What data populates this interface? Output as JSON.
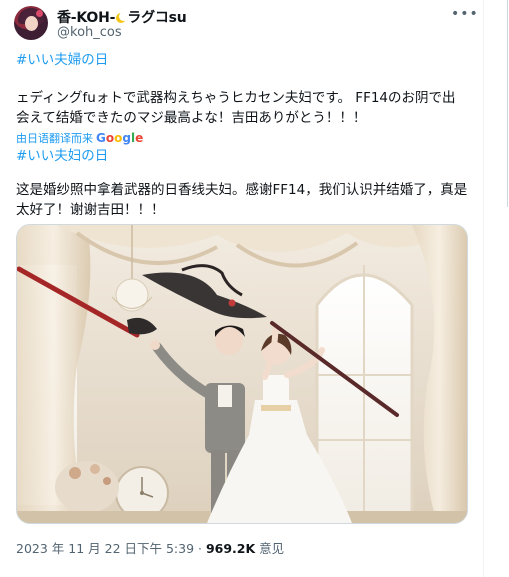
{
  "tweet": {
    "display_name_prefix": "香-KOH-",
    "display_name_suffix": "ラグコsu",
    "handle": "@koh_cos",
    "more_icon": "more-horizontal-icon",
    "hashtag_top": "#いい夫婦の日",
    "body_line1": "ェディングfuォトで武器构えちゃうヒカセン夫妇です。 FF14のお阴で出",
    "body_line2": "会えて结婚できたのマジ最高よな！吉田ありがとう！！！",
    "translated_by": "由日语翻译而来",
    "google_letters": [
      "G",
      "o",
      "o",
      "g",
      "l",
      "e"
    ],
    "hashtag_bottom": "#いい夫妇の日",
    "translation_line1": "这是婚纱照中拿着武器的日香线夫妇。感谢FF14，我们认识并结婚了，真是",
    "translation_line2": "太好了！谢谢吉田！！！",
    "timestamp": "2023 年 11 月 22 日下午 5:39 · ",
    "views_count": "969.2K",
    "views_label": " 意见"
  }
}
